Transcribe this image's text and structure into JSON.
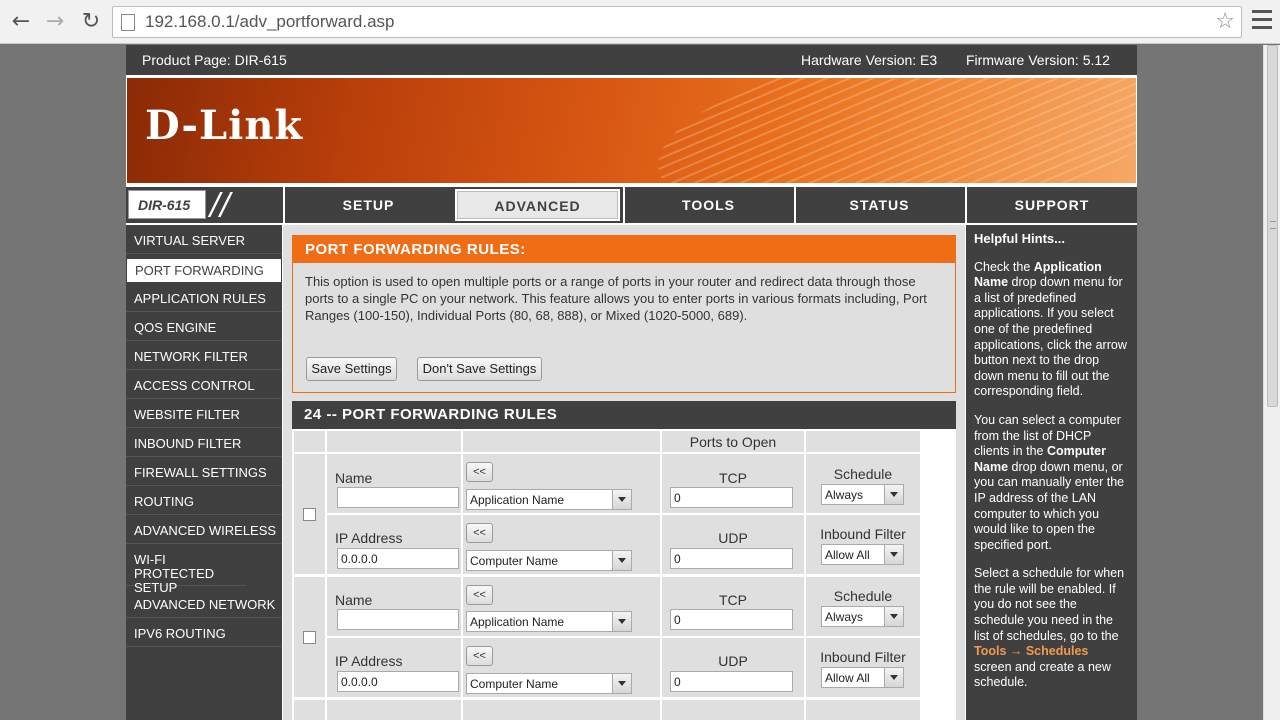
{
  "browser": {
    "url": "192.168.0.1/adv_portforward.asp",
    "back_glyph": "←",
    "forward_glyph": "→",
    "reload_glyph": "↻",
    "star_glyph": "☆"
  },
  "header": {
    "product_page": "Product Page: DIR-615",
    "hardware_version": "Hardware Version: E3",
    "firmware_version": "Firmware Version: 5.12",
    "logo": "D-Link",
    "model": "DIR-615",
    "slashes": "//"
  },
  "tabs": [
    {
      "label": "SETUP"
    },
    {
      "label": "ADVANCED",
      "active": true
    },
    {
      "label": "TOOLS"
    },
    {
      "label": "STATUS"
    },
    {
      "label": "SUPPORT"
    }
  ],
  "sidebar": {
    "items": [
      {
        "label": "VIRTUAL SERVER"
      },
      {
        "label": "PORT FORWARDING",
        "active": true
      },
      {
        "label": "APPLICATION RULES"
      },
      {
        "label": "QOS ENGINE"
      },
      {
        "label": "NETWORK FILTER"
      },
      {
        "label": "ACCESS CONTROL"
      },
      {
        "label": "WEBSITE FILTER"
      },
      {
        "label": "INBOUND FILTER"
      },
      {
        "label": "FIREWALL SETTINGS"
      },
      {
        "label": "ROUTING"
      },
      {
        "label": "ADVANCED WIRELESS"
      },
      {
        "label": "WI-FI PROTECTED SETUP"
      },
      {
        "label": "ADVANCED NETWORK"
      },
      {
        "label": "IPV6 ROUTING"
      }
    ]
  },
  "rules_section": {
    "title": "PORT FORWARDING RULES:",
    "description": "This option is used to open multiple ports or a range of ports in your router and redirect data through those ports to a single PC on your network. This feature allows you to enter ports in various formats including, Port Ranges (100-150), Individual Ports (80, 68, 888), or Mixed (1020-5000, 689).",
    "save_label": "Save Settings",
    "dont_save_label": "Don't Save Settings"
  },
  "table": {
    "title": "24 -- PORT FORWARDING RULES",
    "ports_to_open": "Ports to Open",
    "copy_button": "<<",
    "rows": [
      {
        "name_label": "Name",
        "name_value": "",
        "app_select": "Application Name",
        "tcp_label": "TCP",
        "tcp_value": "0",
        "schedule_label": "Schedule",
        "schedule_value": "Always",
        "ip_label": "IP Address",
        "ip_value": "0.0.0.0",
        "computer_select": "Computer Name",
        "udp_label": "UDP",
        "udp_value": "0",
        "inbound_label": "Inbound Filter",
        "inbound_value": "Allow All"
      },
      {
        "name_label": "Name",
        "name_value": "",
        "app_select": "Application Name",
        "tcp_label": "TCP",
        "tcp_value": "0",
        "schedule_label": "Schedule",
        "schedule_value": "Always",
        "ip_label": "IP Address",
        "ip_value": "0.0.0.0",
        "computer_select": "Computer Name",
        "udp_label": "UDP",
        "udp_value": "0",
        "inbound_label": "Inbound Filter",
        "inbound_value": "Allow All"
      }
    ]
  },
  "hints": {
    "title": "Helpful Hints...",
    "p1_a": "Check the ",
    "p1_b": "Application Name",
    "p1_c": " drop down menu for a list of predefined applications. If you select one of the predefined applications, click the arrow button next to the drop down menu to fill out the corresponding field.",
    "p2_a": "You can select a computer from the list of DHCP clients in the ",
    "p2_b": "Computer Name",
    "p2_c": " drop down menu, or you can manually enter the IP address of the LAN computer to which you would like to open the specified port.",
    "p3_a": "Select a schedule for when the rule will be enabled. If you do not see the schedule you need in the list of schedules, go to the ",
    "p3_link": "Tools → Schedules",
    "p3_c": " screen and create a new schedule."
  }
}
